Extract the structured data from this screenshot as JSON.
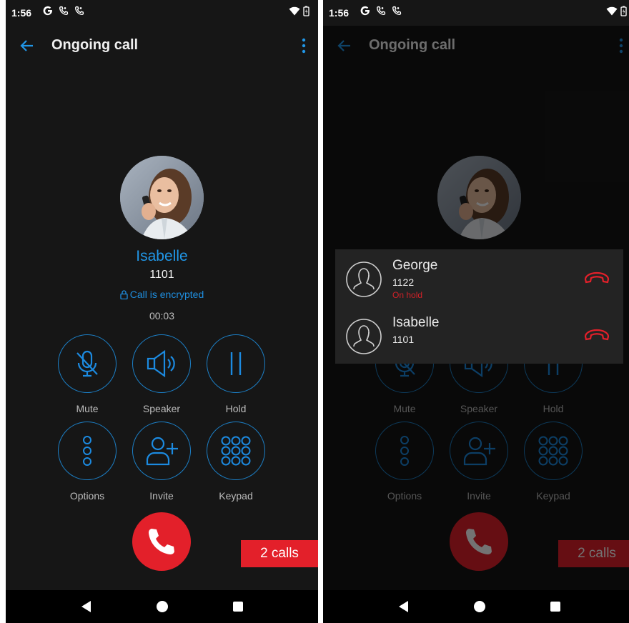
{
  "status_bar": {
    "time": "1:56"
  },
  "app_bar": {
    "title": "Ongoing call"
  },
  "caller": {
    "name": "Isabelle",
    "number": "1101",
    "encrypted_text": "Call is encrypted",
    "duration": "00:03"
  },
  "controls": {
    "mute": "Mute",
    "speaker": "Speaker",
    "hold": "Hold",
    "options": "Options",
    "invite": "Invite",
    "keypad": "Keypad"
  },
  "calls_tab": {
    "label": "2 calls"
  },
  "calls_list": [
    {
      "name": "George",
      "number": "1122",
      "status": "On hold"
    },
    {
      "name": "Isabelle",
      "number": "1101",
      "status": ""
    }
  ],
  "colors": {
    "accent": "#2196e6",
    "end_call": "#e3202a",
    "background": "#161616",
    "on_hold": "#d02128"
  }
}
